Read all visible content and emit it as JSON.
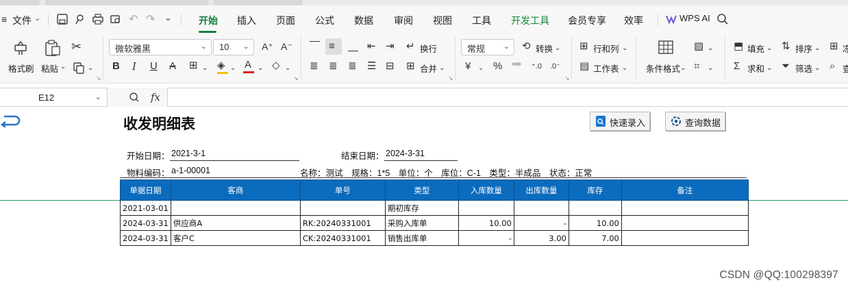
{
  "menubar": {
    "file_label": "文件",
    "tabs": [
      "开始",
      "插入",
      "页面",
      "公式",
      "数据",
      "审阅",
      "视图",
      "工具",
      "开发工具",
      "会员专享",
      "效率"
    ],
    "wps_ai": "WPS AI"
  },
  "ribbon": {
    "format_painter": "格式刷",
    "paste": "粘贴",
    "font_name": "微软雅黑",
    "font_size": "10",
    "wrap": "换行",
    "merge": "合并",
    "number_format": "常规",
    "convert": "转换",
    "rows_cols": "行和列",
    "worksheet": "工作表",
    "cond_format": "条件格式",
    "fill": "填充",
    "sort": "排序",
    "sum": "求和",
    "filter": "筛选",
    "overflow_1": "冻",
    "overflow_2": "查"
  },
  "formula_bar": {
    "cell_ref": "E12",
    "fx": "fx",
    "value": ""
  },
  "report": {
    "title": "收发明细表",
    "btn_quick_entry": "快速录入",
    "btn_query": "查询数据",
    "start_date_label": "开始日期：",
    "start_date": "2021-3-1",
    "end_date_label": "结束日期：",
    "end_date": "2024-3-31",
    "material_code_label": "物料编码：",
    "material_code": "a-1-00001",
    "info": "名称：测试　规格：1*5　单位：个　库位：C-1　类型：半成品　状态：正常",
    "columns": [
      "单据日期",
      "客商",
      "单号",
      "类型",
      "入库数量",
      "出库数量",
      "库存",
      "备注"
    ],
    "rows": [
      [
        "2021-03-01",
        "",
        "",
        "期初库存",
        "",
        "",
        "",
        ""
      ],
      [
        "2024-03-31",
        "供应商A",
        "RK:20240331001",
        "采购入库单",
        "10.00",
        "-",
        "10.00",
        ""
      ],
      [
        "2024-03-31",
        "客户C",
        "CK:20240331001",
        "销售出库单",
        "-",
        "3.00",
        "7.00",
        ""
      ]
    ]
  },
  "colors": {
    "accent_green": "#15803c",
    "table_header_blue": "#0b6bbd"
  },
  "watermark": "CSDN @QQ:100298397"
}
